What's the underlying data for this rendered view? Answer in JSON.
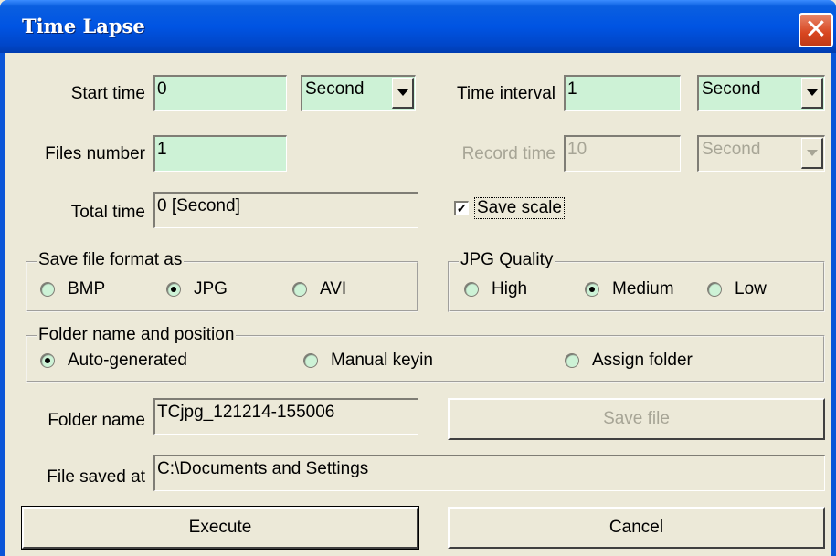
{
  "window": {
    "title": "Time Lapse",
    "close_glyph": "✕"
  },
  "start_time": {
    "label": "Start time",
    "value": "0",
    "unit": "Second"
  },
  "time_interval": {
    "label": "Time interval",
    "value": "1",
    "unit": "Second"
  },
  "files_number": {
    "label": "Files number",
    "value": "1"
  },
  "record_time": {
    "label": "Record time",
    "value": "10",
    "unit": "Second"
  },
  "total_time": {
    "label": "Total time",
    "value": "0 [Second]"
  },
  "save_scale": {
    "label": "Save scale",
    "checked": true,
    "check_glyph": "✓"
  },
  "save_format": {
    "legend": "Save file format as",
    "options": [
      "BMP",
      "JPG",
      "AVI"
    ],
    "selected": "JPG"
  },
  "jpg_quality": {
    "legend": "JPG Quality",
    "options": [
      "High",
      "Medium",
      "Low"
    ],
    "selected": "Medium"
  },
  "folder_position": {
    "legend": "Folder name and position",
    "options": [
      "Auto-generated",
      "Manual keyin",
      "Assign folder"
    ],
    "selected": "Auto-generated"
  },
  "folder_name": {
    "label": "Folder name",
    "value": "TCjpg_121214-155006"
  },
  "save_file_button": "Save file",
  "file_saved_at": {
    "label": "File saved at",
    "value": "C:\\Documents and Settings"
  },
  "execute_button": "Execute",
  "cancel_button": "Cancel",
  "colors": {
    "window_bg": "#ece9d8",
    "field_bg": "#cdf2d6",
    "titlebar": "#0054e3",
    "close": "#d84620"
  }
}
